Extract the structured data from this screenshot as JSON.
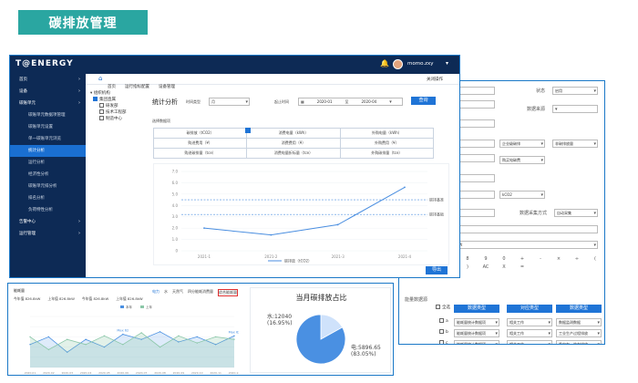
{
  "page_title": "碳排放管理",
  "back_panel": {
    "status_label": "状态",
    "status_value": "启用",
    "data_source_label": "数据来源",
    "select_a": "企业级碳排",
    "select_b": "非碳排放量",
    "select_c": "购买电碳费",
    "select_d": "kCO2",
    "data_collect_label": "数据采集方式",
    "data_collect_value": "自动采集",
    "field_value": "kW",
    "calc_keys": [
      "8",
      "9",
      "0",
      "+",
      "-",
      "×",
      "÷",
      "(",
      ")",
      "AC",
      "X",
      "="
    ],
    "section_label": "能量数据源",
    "col_headers": [
      "数据类型",
      "对应类型",
      "数据类型"
    ],
    "select_all": "全选",
    "rows": [
      {
        "tag": "a",
        "c1": "能耗量统计数据项",
        "c2": "相关工作",
        "c3": "数据监测数据"
      },
      {
        "tag": "b",
        "c1": "能耗量统计数据项",
        "c2": "相关工作",
        "c3": "工业生产过程排放"
      },
      {
        "tag": "c",
        "c1": "能耗量统计数据项",
        "c2": "相关工作",
        "c3": "净电力、热力排放"
      },
      {
        "tag": "d",
        "c1": "能耗量统计数据项",
        "c2": "相关工作",
        "c3": "使用产品排放量项目"
      }
    ]
  },
  "main": {
    "logo": "T@ENERGY",
    "user": "momo.zxy",
    "nav_tabs": [
      "首页",
      "运行指标配置",
      "设备管理"
    ],
    "close_ops": "关闭操作",
    "sidebar": [
      {
        "label": "首页",
        "level": "top"
      },
      {
        "label": "设备",
        "level": "top"
      },
      {
        "label": "碳账单元",
        "level": "top"
      },
      {
        "label": "碳账单元数据项管理",
        "level": "sub"
      },
      {
        "label": "碳账单元设置",
        "level": "sub"
      },
      {
        "label": "单一碳账单元浏览",
        "level": "sub"
      },
      {
        "label": "统计分析",
        "level": "sub",
        "active": true
      },
      {
        "label": "运行分析",
        "level": "sub"
      },
      {
        "label": "经济性分析",
        "level": "sub"
      },
      {
        "label": "碳账单元排分析",
        "level": "sub"
      },
      {
        "label": "排名分析",
        "level": "sub"
      },
      {
        "label": "负荷特性分析",
        "level": "sub"
      },
      {
        "label": "告警中心",
        "level": "top"
      },
      {
        "label": "运行管理",
        "level": "top"
      }
    ],
    "tree": {
      "root": "组织机构",
      "child": "集团直属",
      "items": [
        "研发部",
        "技术工程部",
        "制造中心"
      ]
    },
    "stat_title": "统计分析",
    "time_type_label": "时间类型",
    "time_type_value": "月",
    "period_label": "起止时间",
    "date_from": "2020-01",
    "date_to": "2020-04",
    "date_sep": "至",
    "query_btn": "查询",
    "select_data_label": "选择数据项",
    "data_items": [
      [
        "碳排放（tCO2）",
        "消费电量（kWh）",
        "外购电量（kWh）"
      ],
      [
        "购进费用（¥）",
        "消费费用（¥）",
        "外购费用（¥）"
      ],
      [
        "购进碳排量（tce）",
        "消费电量折标量（tce）",
        "外购碳排量（tce）"
      ]
    ],
    "export_btn": "导出",
    "chart_data": {
      "type": "line",
      "categories": [
        "2021-1",
        "2021-2",
        "2021-3",
        "2021-4"
      ],
      "series": [
        {
          "name": "碳排放（tCO2）",
          "values": [
            2.0,
            1.4,
            2.3,
            5.6
          ]
        }
      ],
      "ylim": [
        0,
        7
      ],
      "yticks": [
        "0",
        "1.0",
        "2.0",
        "3.0",
        "4.0",
        "5.0",
        "6.0",
        "7.0"
      ],
      "reference_lines": [
        {
          "label": "碳排基准",
          "value": 4.5
        },
        {
          "label": "碳排基础",
          "value": 3.2
        }
      ]
    }
  },
  "bottom_left": {
    "title": "能耗量",
    "stats": [
      "今年值 826.8kW",
      "上年值 826.8kW",
      "今年值 826.8kW",
      "上年值 826.8kW"
    ],
    "tabs": [
      "电力",
      "水",
      "天然气",
      "四分能耗消费量",
      "综合能耗量"
    ],
    "legend": [
      "本年",
      "上年"
    ],
    "chart_data": {
      "type": "line",
      "categories": [
        "2020-01",
        "2020-02",
        "2020-03",
        "2020-04",
        "2020-05",
        "2020-06",
        "2020-07",
        "2020-08",
        "2020-09",
        "2020-10",
        "2020-11",
        "2020-12"
      ],
      "series": [
        {
          "name": "本年",
          "values": [
            45,
            60,
            30,
            55,
            40,
            65,
            55,
            70,
            50,
            60,
            45,
            62
          ]
        },
        {
          "name": "上年",
          "values": [
            60,
            35,
            55,
            45,
            62,
            45,
            68,
            40,
            62,
            48,
            60,
            55
          ]
        }
      ],
      "ylim": [
        0,
        100
      ],
      "annotations": [
        "Max 62",
        "Max 62"
      ]
    }
  },
  "pie": {
    "title": "当月碳排放占比",
    "chart_data": {
      "type": "pie",
      "slices": [
        {
          "label": "水",
          "value": 12040,
          "percent": "16.95%"
        },
        {
          "label": "电",
          "value": 5896.65,
          "percent": "83.05%"
        }
      ]
    },
    "label_water_1": "水:12040",
    "label_water_2": "(16.95%)",
    "label_elec_1": "电:5896.65",
    "label_elec_2": "(83.05%)",
    "colors": {
      "elec": "#4a90e2",
      "water": "#cfe2fb"
    }
  }
}
